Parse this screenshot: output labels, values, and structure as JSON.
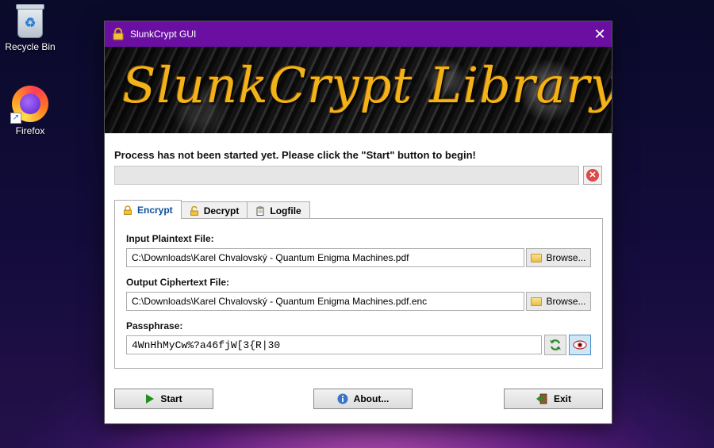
{
  "desktop": {
    "icons": [
      {
        "label": "Recycle Bin",
        "icon": "recycle-bin-icon"
      },
      {
        "label": "Firefox",
        "icon": "firefox-icon"
      }
    ]
  },
  "window": {
    "title": "SlunkCrypt GUI",
    "close_glyph": "✕",
    "banner_text": "SlunkCrypt Library"
  },
  "status": {
    "message": "Process has not been started yet. Please click the \"Start\" button to begin!",
    "progress_fraction": 0,
    "abort_glyph": "✕"
  },
  "tabs": [
    {
      "label": "Encrypt",
      "icon": "lock-icon",
      "active": true
    },
    {
      "label": "Decrypt",
      "icon": "unlock-icon",
      "active": false
    },
    {
      "label": "Logfile",
      "icon": "clipboard-icon",
      "active": false
    }
  ],
  "encrypt": {
    "input_label": "Input Plaintext File:",
    "input_value": "C:\\Downloads\\Karel Chvalovský - Quantum Enigma Machines.pdf",
    "output_label": "Output Ciphertext File:",
    "output_value": "C:\\Downloads\\Karel Chvalovský - Quantum Enigma Machines.pdf.enc",
    "browse_label": "Browse...",
    "passphrase_label": "Passphrase:",
    "passphrase_value": "4WnHhMyCw%?a46fjW[3{R|30"
  },
  "footer": {
    "start_label": "Start",
    "about_label": "About...",
    "exit_label": "Exit"
  },
  "colors": {
    "titlebar": "#6b0fa3",
    "active_tab_text": "#0b4f9c",
    "banner_text": "#f2b21a"
  }
}
